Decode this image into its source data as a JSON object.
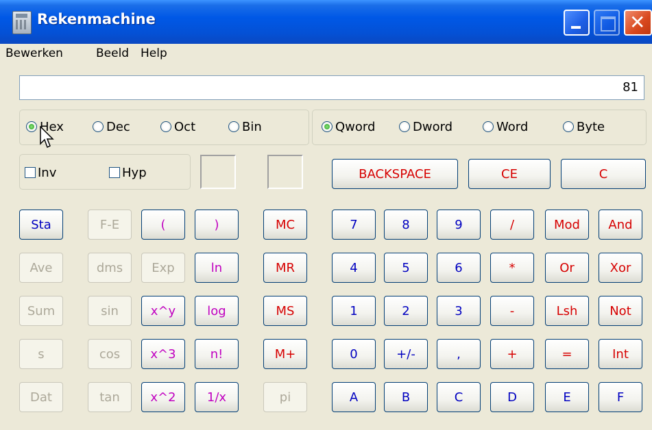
{
  "window": {
    "title": "Rekenmachine"
  },
  "menu": [
    "Bewerken",
    "Beeld",
    "Help"
  ],
  "display": {
    "value": "81"
  },
  "bases": [
    {
      "label": "Hex",
      "selected": true
    },
    {
      "label": "Dec",
      "selected": false
    },
    {
      "label": "Oct",
      "selected": false
    },
    {
      "label": "Bin",
      "selected": false
    }
  ],
  "sizes": [
    {
      "label": "Qword",
      "selected": true
    },
    {
      "label": "Dword",
      "selected": false
    },
    {
      "label": "Word",
      "selected": false
    },
    {
      "label": "Byte",
      "selected": false
    }
  ],
  "options": {
    "inv": "Inv",
    "hyp": "Hyp"
  },
  "edit_buttons": {
    "backspace": "BACKSPACE",
    "ce": "CE",
    "c": "C"
  },
  "sci_keys": [
    [
      "Sta",
      "F-E",
      "(",
      ")"
    ],
    [
      "Ave",
      "dms",
      "Exp",
      "ln"
    ],
    [
      "Sum",
      "sin",
      "x^y",
      "log"
    ],
    [
      "s",
      "cos",
      "x^3",
      "n!"
    ],
    [
      "Dat",
      "tan",
      "x^2",
      "1/x"
    ]
  ],
  "mem_keys": [
    "MC",
    "MR",
    "MS",
    "M+",
    "pi"
  ],
  "num_keys": [
    [
      "7",
      "8",
      "9",
      "/",
      "Mod",
      "And"
    ],
    [
      "4",
      "5",
      "6",
      "*",
      "Or",
      "Xor"
    ],
    [
      "1",
      "2",
      "3",
      "-",
      "Lsh",
      "Not"
    ],
    [
      "0",
      "+/-",
      ",",
      "+",
      "=",
      "Int"
    ],
    [
      "A",
      "B",
      "C",
      "D",
      "E",
      "F"
    ]
  ]
}
